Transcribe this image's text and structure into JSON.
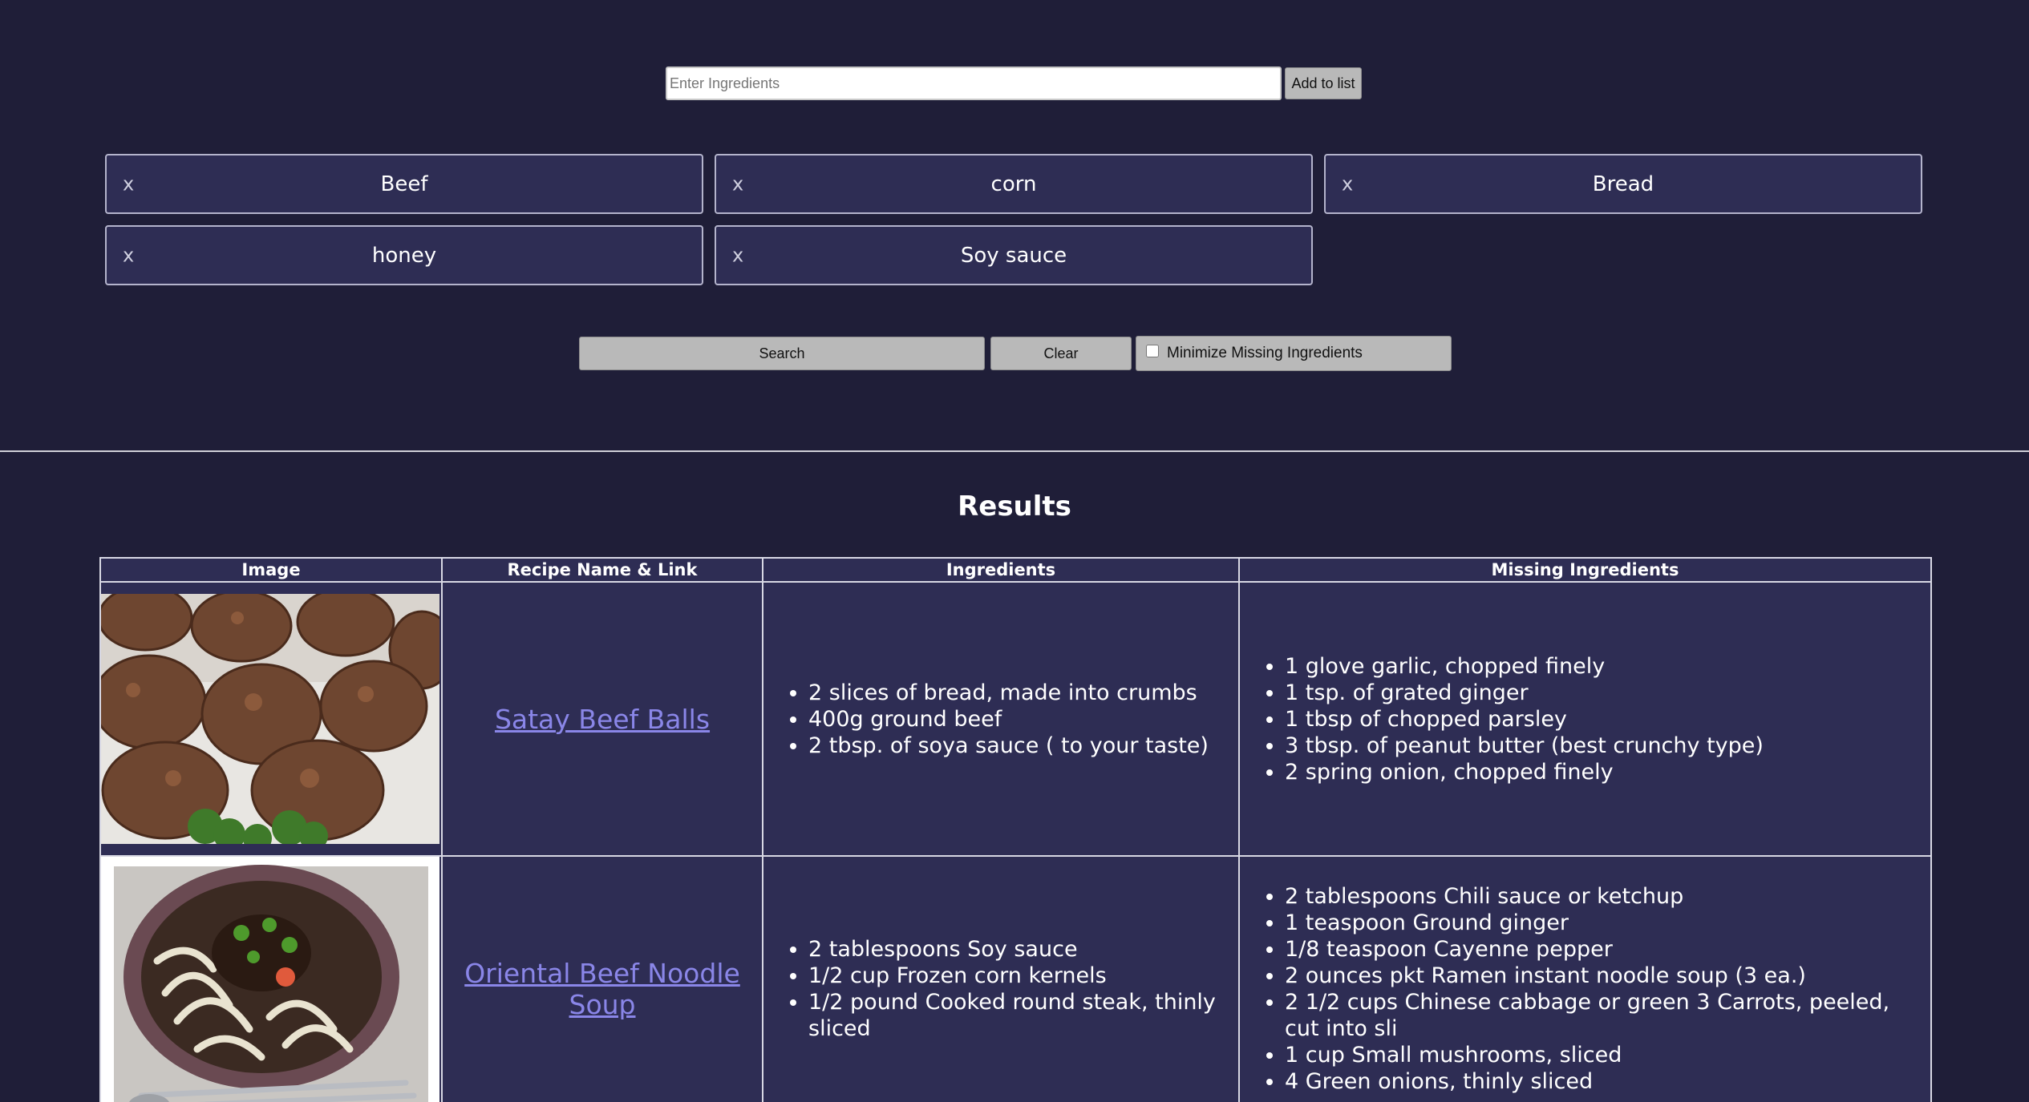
{
  "entry": {
    "placeholder": "Enter Ingredients",
    "add_label": "Add to list"
  },
  "chips": [
    {
      "remove": "x",
      "label": "Beef"
    },
    {
      "remove": "x",
      "label": "corn"
    },
    {
      "remove": "x",
      "label": "Bread"
    },
    {
      "remove": "x",
      "label": "honey"
    },
    {
      "remove": "x",
      "label": "Soy sauce"
    }
  ],
  "actions": {
    "search_label": "Search",
    "clear_label": "Clear",
    "minimize_label": "Minimize Missing Ingredients",
    "minimize_checked": false
  },
  "results": {
    "title": "Results",
    "headers": {
      "image": "Image",
      "recipe": "Recipe Name & Link",
      "ingredients": "Ingredients",
      "missing": "Missing Ingredients"
    },
    "rows": [
      {
        "name": "Satay Beef Balls",
        "ingredients": [
          "2 slices of bread, made into crumbs",
          "400g ground beef",
          "2 tbsp. of soya sauce ( to your taste)"
        ],
        "missing": [
          "1 glove garlic, chopped finely",
          "1 tsp. of grated ginger",
          "1 tbsp of chopped parsley",
          "3 tbsp. of peanut butter (best crunchy type)",
          "2 spring onion, chopped finely"
        ]
      },
      {
        "name": "Oriental Beef Noodle Soup",
        "ingredients": [
          "2 tablespoons Soy sauce",
          "1/2 cup Frozen corn kernels",
          "1/2 pound Cooked round steak, thinly sliced"
        ],
        "missing": [
          "2 tablespoons Chili sauce or ketchup",
          "1 teaspoon Ground ginger",
          "1/8 teaspoon Cayenne pepper",
          "2 ounces pkt Ramen instant noodle soup (3 ea.)",
          "2 1/2 cups Chinese cabbage or green 3 Carrots, peeled, cut into sli",
          "1 cup Small mushrooms, sliced",
          "4 Green onions, thinly sliced"
        ]
      }
    ]
  }
}
